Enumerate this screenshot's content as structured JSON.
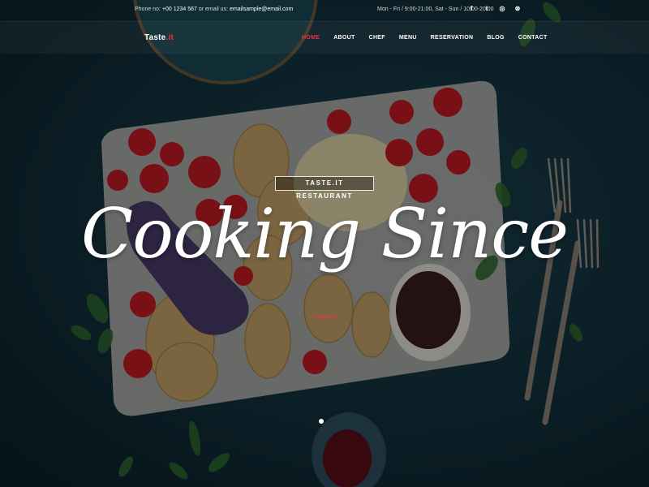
{
  "topbar": {
    "phone_label": "Phone no:",
    "phone": "+00 1234 567",
    "email_label": "or email us:",
    "email": "emailsample@email.com",
    "hours": "Mon - Fri / 9:00-21:00, Sat - Sun / 10:00-20:00",
    "socials": [
      {
        "icon": "facebook-icon",
        "glyph": "f"
      },
      {
        "icon": "twitter-icon",
        "glyph": "t"
      },
      {
        "icon": "instagram-icon",
        "glyph": "◎"
      },
      {
        "icon": "dribbble-icon",
        "glyph": "⊛"
      }
    ]
  },
  "nav": {
    "logo_main": "Taste",
    "logo_accent": ".it",
    "items": [
      "HOME",
      "ABOUT",
      "CHEF",
      "MENU",
      "RESERVATION",
      "BLOG",
      "CONTACT"
    ],
    "active": "HOME"
  },
  "hero": {
    "tagline": "TASTE.IT RESTAURANT",
    "headline": "Cooking Since"
  },
  "colors": {
    "accent": "#e2344a",
    "background": "#143441"
  }
}
